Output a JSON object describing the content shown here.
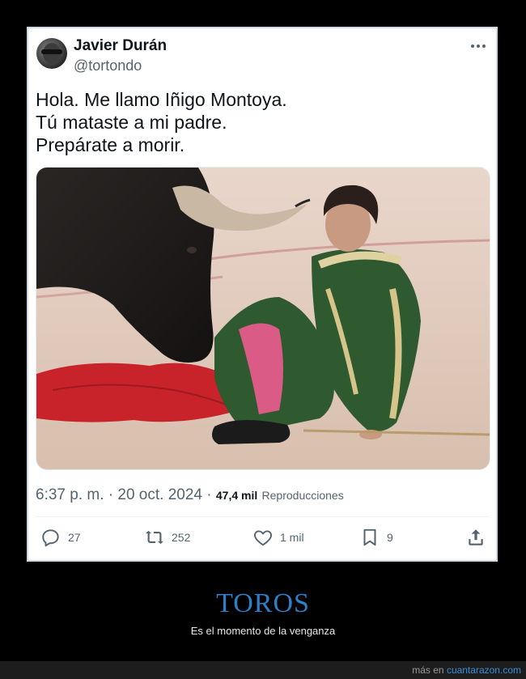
{
  "tweet": {
    "author_name": "Javier Durán",
    "author_handle": "@tortondo",
    "text_lines": [
      "Hola. Me llamo Iñigo Montoya.",
      "Tú mataste a mi padre.",
      "Prepárate a morir."
    ],
    "time": "6:37 p. m.",
    "separator": " · ",
    "date": "20 oct. 2024",
    "views_count": "47,4 mil",
    "views_label": "Reproducciones",
    "actions": {
      "replies": "27",
      "retweets": "252",
      "likes": "1 mil",
      "bookmarks": "9"
    }
  },
  "caption": {
    "title": "TOROS",
    "subtitle": "Es el momento de la venganza"
  },
  "footer": {
    "prefix": "más en",
    "site": "cuantarazon.com"
  },
  "icons": {
    "more": "more-horizontal-icon",
    "reply": "reply-icon",
    "retweet": "retweet-icon",
    "like": "heart-icon",
    "bookmark": "bookmark-icon",
    "share": "share-icon"
  },
  "colors": {
    "page_background": "#000000",
    "card_background": "#ffffff",
    "card_border": "#cfd9e6",
    "caption_title": "#2f7fc4",
    "footer_link": "#3a8fd9",
    "text_secondary": "#536471"
  }
}
